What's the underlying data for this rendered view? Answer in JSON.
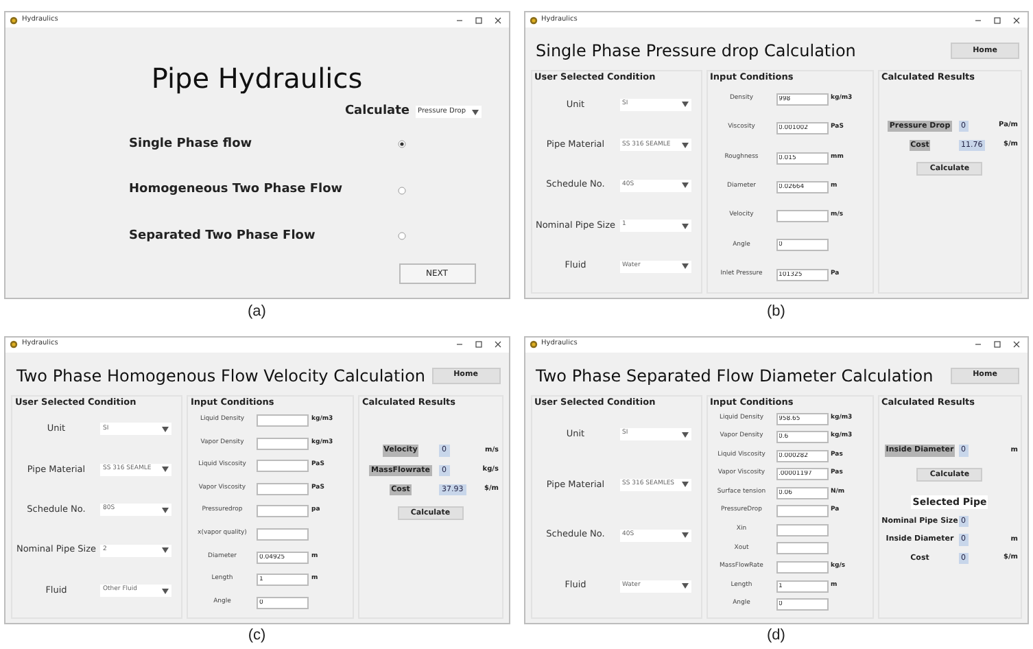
{
  "panels": [
    {
      "kind": "home",
      "caption": "(a)",
      "window": {
        "title": "Hydraulics"
      },
      "heading": "Pipe Hydraulics",
      "calculate": {
        "label": "Calculate",
        "value": "Pressure Drop"
      },
      "options": [
        {
          "label": "Single Phase flow",
          "selected": true
        },
        {
          "label": "Homogeneous Two Phase Flow",
          "selected": false
        },
        {
          "label": "Separated Two Phase Flow",
          "selected": false
        }
      ],
      "next_button": "NEXT"
    },
    {
      "kind": "calc",
      "caption": "(b)",
      "window": {
        "title": "Hydraulics"
      },
      "heading": "Single Phase Pressure drop Calculation",
      "home_button": "Home",
      "conditions": {
        "title": "User Selected Condition",
        "fields": [
          {
            "label": "Unit",
            "value": "SI"
          },
          {
            "label": "Pipe Material",
            "value": "SS 316 SEAMLE"
          },
          {
            "label": "Schedule No.",
            "value": "40S"
          },
          {
            "label": "Nominal Pipe Size",
            "value": "1"
          },
          {
            "label": "Fluid",
            "value": "Water"
          }
        ]
      },
      "inputs": {
        "title": "Input Conditions",
        "fields": [
          {
            "label": "Density",
            "value": "998",
            "unit": "kg/m3"
          },
          {
            "label": "Viscosity",
            "value": "0.001002",
            "unit": "PaS"
          },
          {
            "label": "Roughness",
            "value": "0.015",
            "unit": "mm"
          },
          {
            "label": "Diameter",
            "value": "0.02664",
            "unit": "m"
          },
          {
            "label": "Velocity",
            "unit": "m/s"
          },
          {
            "label": "Angle",
            "value": "0"
          },
          {
            "label": "Inlet Pressure",
            "value": "101325",
            "unit": "Pa"
          }
        ]
      },
      "results": {
        "title": "Calculated Results",
        "items": [
          {
            "label": "Pressure Drop",
            "value": "0",
            "unit": "Pa/m"
          },
          {
            "label": "Cost",
            "value": "11.76",
            "unit": "$/m"
          }
        ],
        "button": "Calculate"
      }
    },
    {
      "kind": "calc",
      "caption": "(c)",
      "window": {
        "title": "Hydraulics"
      },
      "heading": "Two Phase Homogenous Flow Velocity Calculation",
      "home_button": "Home",
      "conditions": {
        "title": "User Selected Condition",
        "fields": [
          {
            "label": "Unit",
            "value": "SI"
          },
          {
            "label": "Pipe Material",
            "value": "SS 316 SEAMLE"
          },
          {
            "label": "Schedule No.",
            "value": "80S"
          },
          {
            "label": "Nominal Pipe Size",
            "value": "2"
          },
          {
            "label": "Fluid",
            "value": "Other Fluid"
          }
        ]
      },
      "inputs": {
        "title": "Input Conditions",
        "fields": [
          {
            "label": "Liquid Density",
            "unit": "kg/m3"
          },
          {
            "label": "Vapor Density",
            "unit": "kg/m3"
          },
          {
            "label": "Liquid Viscosity",
            "unit": "PaS"
          },
          {
            "label": "Vapor Viscosity",
            "unit": "PaS"
          },
          {
            "label": "Pressuredrop",
            "unit": "pa"
          },
          {
            "label": "x(vapor quality)"
          },
          {
            "label": "Diameter",
            "value": "0.04925",
            "unit": "m"
          },
          {
            "label": "Length",
            "value": "1",
            "unit": "m"
          },
          {
            "label": "Angle",
            "value": "0"
          }
        ]
      },
      "results": {
        "title": "Calculated Results",
        "items": [
          {
            "label": "Velocity",
            "value": "0",
            "unit": "m/s"
          },
          {
            "label": "MassFlowrate",
            "value": "0",
            "unit": "kg/s"
          },
          {
            "label": "Cost",
            "value": "37.93",
            "unit": "$/m"
          }
        ],
        "button": "Calculate"
      }
    },
    {
      "kind": "calc",
      "caption": "(d)",
      "window": {
        "title": "Hydraulics"
      },
      "heading": "Two Phase Separated Flow Diameter Calculation",
      "home_button": "Home",
      "conditions": {
        "title": "User Selected Condition",
        "fields": [
          {
            "label": "Unit",
            "value": "SI"
          },
          {
            "label": "Pipe Material",
            "value": "SS 316 SEAMLES"
          },
          {
            "label": "Schedule No.",
            "value": "40S"
          },
          {
            "label": "Fluid",
            "value": "Water"
          }
        ]
      },
      "inputs": {
        "title": "Input Conditions",
        "fields": [
          {
            "label": "Liquid Density",
            "value": "958.65",
            "unit": "kg/m3"
          },
          {
            "label": "Vapor Density",
            "value": "0.6",
            "unit": "kg/m3"
          },
          {
            "label": "Liquid Viscosity",
            "value": "0.000282",
            "unit": "Pas"
          },
          {
            "label": "Vapor Viscosity",
            "value": ".00001197",
            "unit": "Pas"
          },
          {
            "label": "Surface tension",
            "value": "0.06",
            "unit": "N/m"
          },
          {
            "label": "PressureDrop",
            "unit": "Pa"
          },
          {
            "label": "Xin"
          },
          {
            "label": "Xout"
          },
          {
            "label": "MassFlowRate",
            "unit": "kg/s"
          },
          {
            "label": "Length",
            "value": "1",
            "unit": "m"
          },
          {
            "label": "Angle",
            "value": "0"
          }
        ]
      },
      "results": {
        "title": "Calculated Results",
        "items": [
          {
            "label": "Inside Diameter",
            "value": "0",
            "unit": "m"
          }
        ],
        "button": "Calculate",
        "selected_pipe": {
          "title": "Selected Pipe",
          "items": [
            {
              "label": "Nominal Pipe Size",
              "value": "0"
            },
            {
              "label": "Inside Diameter",
              "value": "0",
              "unit": "m"
            },
            {
              "label": "Cost",
              "value": "0",
              "unit": "$/m"
            }
          ]
        }
      }
    }
  ]
}
